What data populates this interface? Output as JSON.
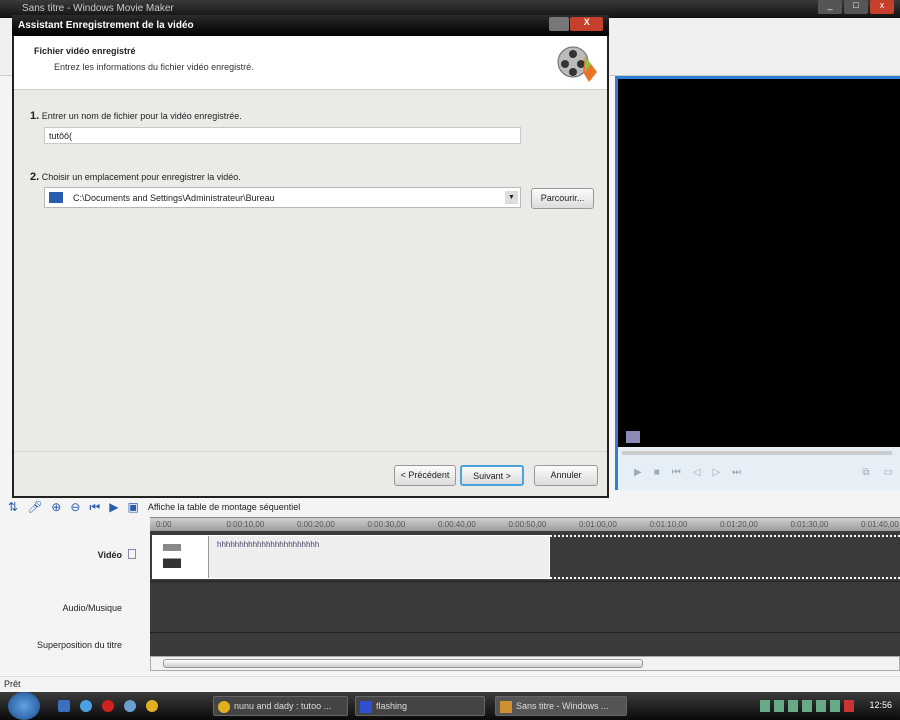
{
  "app": {
    "title": "Sans titre - Windows Movie Maker"
  },
  "dialog": {
    "title": "Assistant Enregistrement de la vidéo",
    "close_label": "X",
    "header_title": "Fichier vidéo enregistré",
    "header_subtitle": "Entrez les informations du fichier vidéo enregistré.",
    "step1_num": "1.",
    "step1_label": "Entrer un nom de fichier pour la vidéo enregistrée.",
    "filename_value": "tutôô(",
    "step2_num": "2.",
    "step2_label": "Choisir un emplacement pour enregistrer la vidéo.",
    "location_value": "C:\\Documents and Settings\\Administrateur\\Bureau",
    "browse_label": "Parcourir...",
    "prev_label": "< Précédent",
    "next_label": "Suivant >",
    "cancel_label": "Annuler"
  },
  "timeline": {
    "storyboard_label": "Affiche la table de montage séquentiel",
    "ruler": [
      "0:00",
      "0:00:10,00",
      "0:00:20,00",
      "0:00:30,00",
      "0:00:40,00",
      "0:00:50,00",
      "0:01:00,00",
      "0:01:10,00",
      "0:01:20,00",
      "0:01:30,00",
      "0:01:40,00"
    ],
    "tracks": [
      "Vidéo",
      "Audio/Musique",
      "Superposition du titre"
    ],
    "clip_name": "hhhhhhhhhhhhhhhhhhhhhhh"
  },
  "status": "Prêt",
  "taskbar": {
    "tasks": [
      "nunu and dady : tutoo ...",
      "flashing",
      "Sans titre - Windows ..."
    ],
    "clock": "12:56"
  },
  "colors": {
    "accent": "#2f7fd6",
    "close": "#c4402c"
  }
}
